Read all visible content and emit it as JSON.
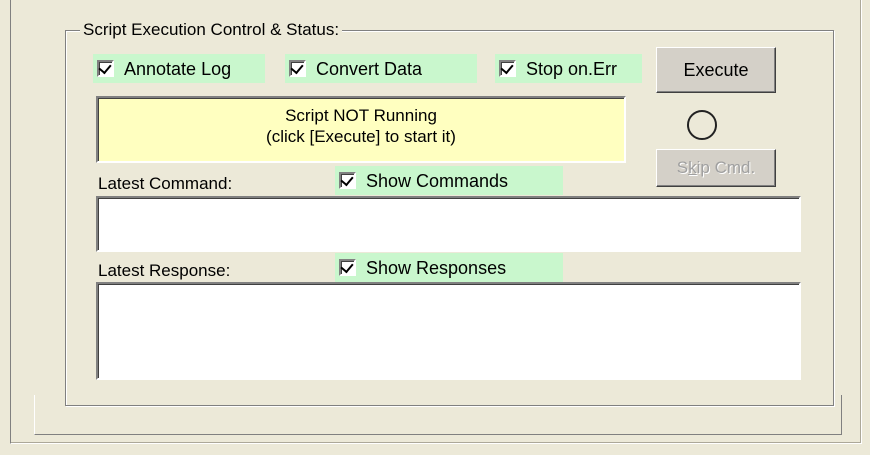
{
  "group": {
    "title": "Script Execution Control & Status:"
  },
  "options": {
    "annotate_log": {
      "label": "Annotate Log",
      "checked": true
    },
    "convert_data": {
      "label": "Convert Data",
      "checked": true
    },
    "stop_on_err": {
      "label": "Stop on.Err",
      "checked": true
    },
    "show_commands": {
      "label": "Show Commands",
      "checked": true
    },
    "show_responses": {
      "label": "Show Responses",
      "checked": true
    }
  },
  "status": {
    "line1": "Script NOT Running",
    "line2": "(click [Execute] to start it)",
    "background": "#ffffc0"
  },
  "buttons": {
    "execute": "Execute",
    "skip_cmd_prefix": "S",
    "skip_cmd_mnemonic": "k",
    "skip_cmd_suffix": "ip Cmd."
  },
  "indicator": {
    "state": "off"
  },
  "latest_command": {
    "label": "Latest Command:",
    "value": ""
  },
  "latest_response": {
    "label": "Latest Response:",
    "value": ""
  },
  "colors": {
    "checkbox_bg": "#c9f7cd",
    "window_bg": "#ece9d8"
  }
}
